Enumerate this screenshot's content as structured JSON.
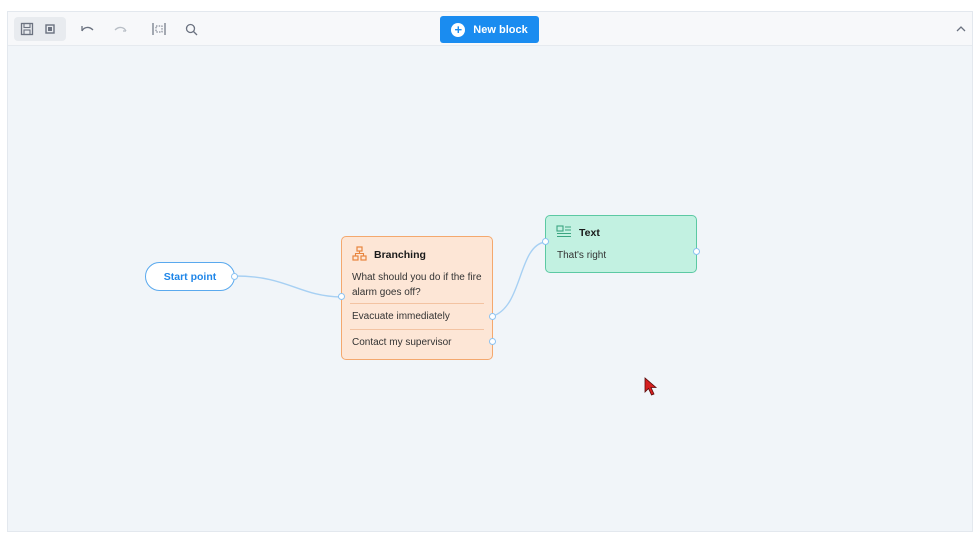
{
  "toolbar": {
    "save_icon": "floppy-disk-icon",
    "stop_icon": "square-icon",
    "undo_icon": "undo-icon",
    "redo_icon": "redo-icon",
    "fit_icon": "fit-view-icon",
    "search_icon": "search-icon",
    "new_block_label": "New block",
    "collapse_icon": "chevron-up-icon",
    "accent_color": "#1a8cf0"
  },
  "canvas": {
    "start_node": {
      "label": "Start point",
      "color": "#1f86e8"
    },
    "branching_node": {
      "title": "Branching",
      "icon": "hierarchy-icon",
      "question": "What should you do if the fire alarm goes off?",
      "options": [
        "Evacuate immediately",
        "Contact my supervisor"
      ],
      "color": "#fde6d6"
    },
    "text_node": {
      "title": "Text",
      "icon": "text-block-icon",
      "body": "That's right",
      "color": "#c2f1e1"
    }
  }
}
